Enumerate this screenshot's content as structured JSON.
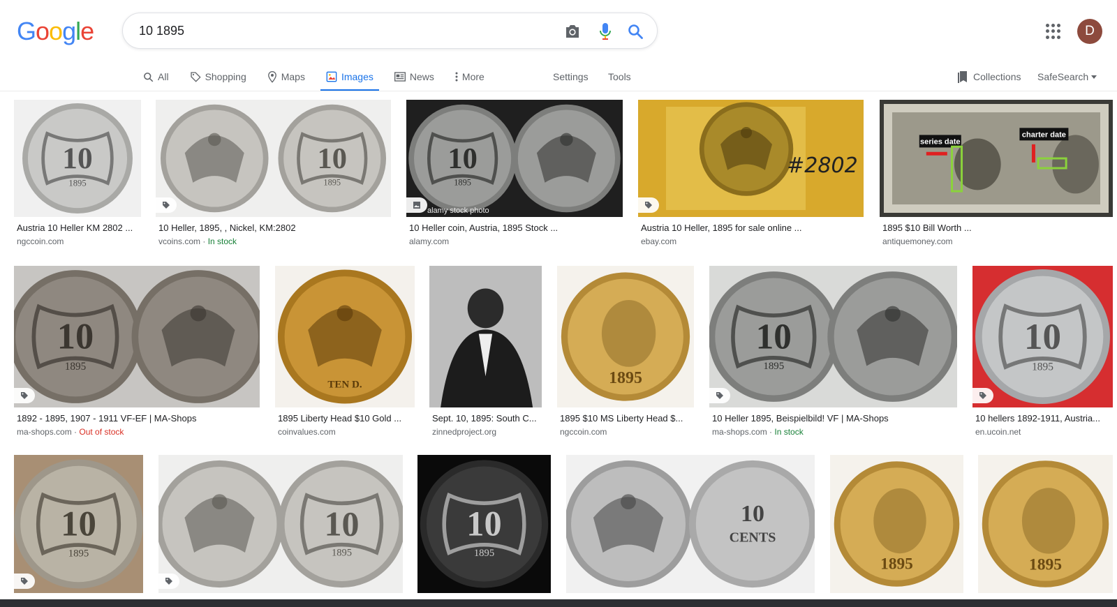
{
  "logo": {
    "letters": [
      {
        "ch": "G",
        "color": "#4285f4"
      },
      {
        "ch": "o",
        "color": "#ea4335"
      },
      {
        "ch": "o",
        "color": "#fbbc05"
      },
      {
        "ch": "g",
        "color": "#4285f4"
      },
      {
        "ch": "l",
        "color": "#34a853"
      },
      {
        "ch": "e",
        "color": "#ea4335"
      }
    ]
  },
  "search": {
    "query": "10 1895"
  },
  "user": {
    "initial": "D"
  },
  "tabs": [
    {
      "label": "All",
      "icon": "search-icon"
    },
    {
      "label": "Shopping",
      "icon": "tag-icon"
    },
    {
      "label": "Maps",
      "icon": "map-pin-icon"
    },
    {
      "label": "Images",
      "icon": "image-icon",
      "active": true
    },
    {
      "label": "News",
      "icon": "news-icon"
    },
    {
      "label": "More",
      "icon": "more-vert-icon"
    }
  ],
  "tools": {
    "settings": "Settings",
    "tools": "Tools",
    "collections": "Collections",
    "safesearch": "SafeSearch"
  },
  "colors": {
    "accent": "#1a73e8",
    "in_stock": "#188038",
    "out_of_stock": "#d93025"
  },
  "results": [
    {
      "title": "Austria 10 Heller KM 2802 ...",
      "source": "ngccoin.com"
    },
    {
      "title": "10 Heller, 1895, , Nickel, KM:2802",
      "source": "vcoins.com",
      "stock": "In stock"
    },
    {
      "title": "10 Heller coin, Austria, 1895 Stock ...",
      "source": "alamy.com",
      "watermark": "alamy stock photo"
    },
    {
      "title": "Austria 10 Heller, 1895 for sale online ...",
      "source": "ebay.com",
      "overlay": "#2802"
    },
    {
      "title": "1895 $10 Bill Worth ...",
      "source": "antiquemoney.com",
      "labels": [
        "series date",
        "charter date"
      ]
    },
    {
      "title": "1892 - 1895, 1907 - 1911 VF-EF | MA-Shops",
      "source": "ma-shops.com",
      "stock": "Out of stock"
    },
    {
      "title": "1895 Liberty Head $10 Gold ...",
      "source": "coinvalues.com",
      "overlay": "TEN D."
    },
    {
      "title": "Sept. 10, 1895: South C...",
      "source": "zinnedproject.org"
    },
    {
      "title": "1895 $10 MS Liberty Head $...",
      "source": "ngccoin.com"
    },
    {
      "title": "10 Heller 1895, Beispielbild! VF | MA-Shops",
      "source": "ma-shops.com",
      "stock": "In stock"
    },
    {
      "title": "10 hellers 1892-1911, Austria...",
      "source": "en.ucoin.net"
    },
    {
      "title": "",
      "source": ""
    },
    {
      "title": "",
      "source": ""
    },
    {
      "title": "",
      "source": ""
    },
    {
      "title": "",
      "source": "",
      "overlay": "CENTS"
    },
    {
      "title": "",
      "source": ""
    },
    {
      "title": "",
      "source": ""
    }
  ],
  "coin_text": {
    "ten": "10",
    "year": "1895"
  }
}
